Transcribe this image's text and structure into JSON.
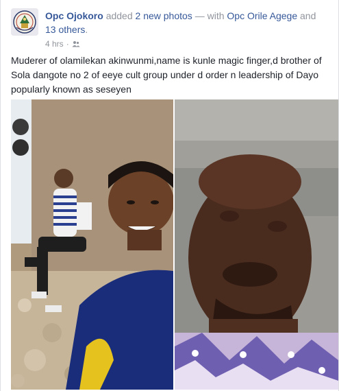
{
  "post": {
    "author": "Opc Ojokoro",
    "action_pre": "added",
    "photos_link": "2 new photos",
    "with_text": "— with",
    "tagged_name": "Opc Orile Agege",
    "and_text": "and",
    "others_link": "13 others",
    "period": ".",
    "time": "4 hrs",
    "separator": "·",
    "audience_icon": "friends-icon",
    "text": "Muderer of olamilekan akinwunmi,name is kunle magic finger,d brother of Sola dangote no 2 of eeye cult group under d order n leadership of Dayo popularly known as seseyen"
  },
  "colors": {
    "link": "#365899",
    "meta": "#90949c",
    "text": "#1d2129"
  }
}
